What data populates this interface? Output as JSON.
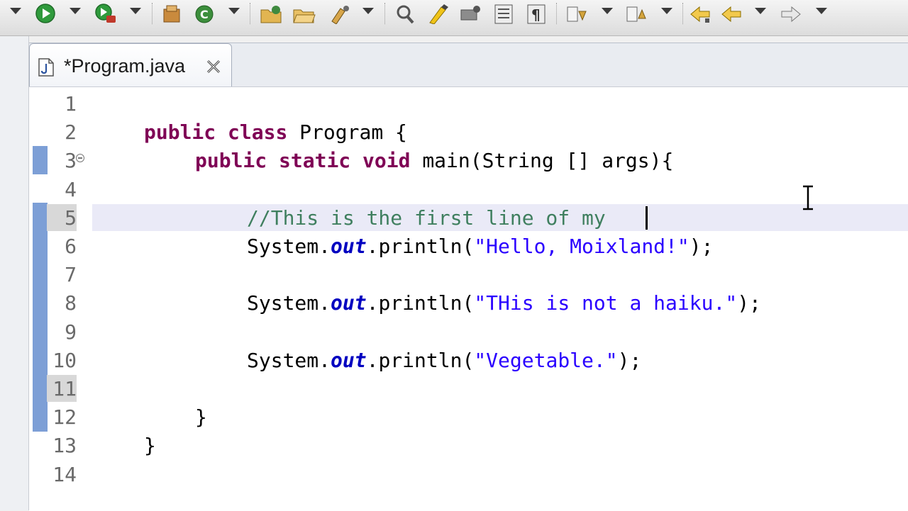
{
  "toolbar": {
    "icons": [
      "debug-icon",
      "run-icon",
      "external-tools-icon",
      "new-java-package-icon",
      "new-java-class-icon",
      "open-type-icon",
      "open-folder-icon",
      "open-task-icon",
      "search-icon",
      "toggle-mark-occurrences-icon",
      "highlight-icon",
      "show-whitespace-icon",
      "block-selection-icon",
      "next-annotation-icon",
      "previous-annotation-icon",
      "last-edit-location-icon",
      "back-icon",
      "forward-icon"
    ]
  },
  "editor": {
    "tab_title": "*Program.java",
    "current_line": 5,
    "lines": [
      {
        "num": "1",
        "tokens": []
      },
      {
        "num": "2",
        "tokens": [
          [
            "kw",
            "public"
          ],
          [
            "p",
            " "
          ],
          [
            "kw",
            "class"
          ],
          [
            "p",
            " Program {"
          ]
        ]
      },
      {
        "num": "3",
        "tokens": [
          [
            "kw",
            "public"
          ],
          [
            "p",
            " "
          ],
          [
            "kw",
            "static"
          ],
          [
            "p",
            " "
          ],
          [
            "kw",
            "void"
          ],
          [
            "p",
            " main(String [] args){"
          ]
        ]
      },
      {
        "num": "4",
        "tokens": []
      },
      {
        "num": "5",
        "tokens": [
          [
            "cm",
            "//This is the first line of my "
          ]
        ]
      },
      {
        "num": "6",
        "tokens": [
          [
            "p",
            "System."
          ],
          [
            "fld",
            "out"
          ],
          [
            "p",
            ".println("
          ],
          [
            "st",
            "\"Hello, Moixland!\""
          ],
          [
            "p",
            ");"
          ]
        ]
      },
      {
        "num": "7",
        "tokens": []
      },
      {
        "num": "8",
        "tokens": [
          [
            "p",
            "System."
          ],
          [
            "fld",
            "out"
          ],
          [
            "p",
            ".println("
          ],
          [
            "st",
            "\"THis is not a haiku.\""
          ],
          [
            "p",
            ");"
          ]
        ]
      },
      {
        "num": "9",
        "tokens": []
      },
      {
        "num": "10",
        "tokens": [
          [
            "p",
            "System."
          ],
          [
            "fld",
            "out"
          ],
          [
            "p",
            ".println("
          ],
          [
            "st",
            "\"Vegetable.\""
          ],
          [
            "p",
            ");"
          ]
        ]
      },
      {
        "num": "11",
        "tokens": []
      },
      {
        "num": "12",
        "tokens": [
          [
            "p",
            "}"
          ]
        ]
      },
      {
        "num": "13",
        "tokens": [
          [
            "p",
            "}"
          ]
        ]
      },
      {
        "num": "14",
        "tokens": []
      }
    ]
  },
  "colors": {
    "keyword": "#7f0055",
    "comment": "#3f7f5f",
    "string": "#2a00ff",
    "field": "#0000c0",
    "change_bar": "#7d9fd6",
    "current_line": "#eaeaf7"
  }
}
